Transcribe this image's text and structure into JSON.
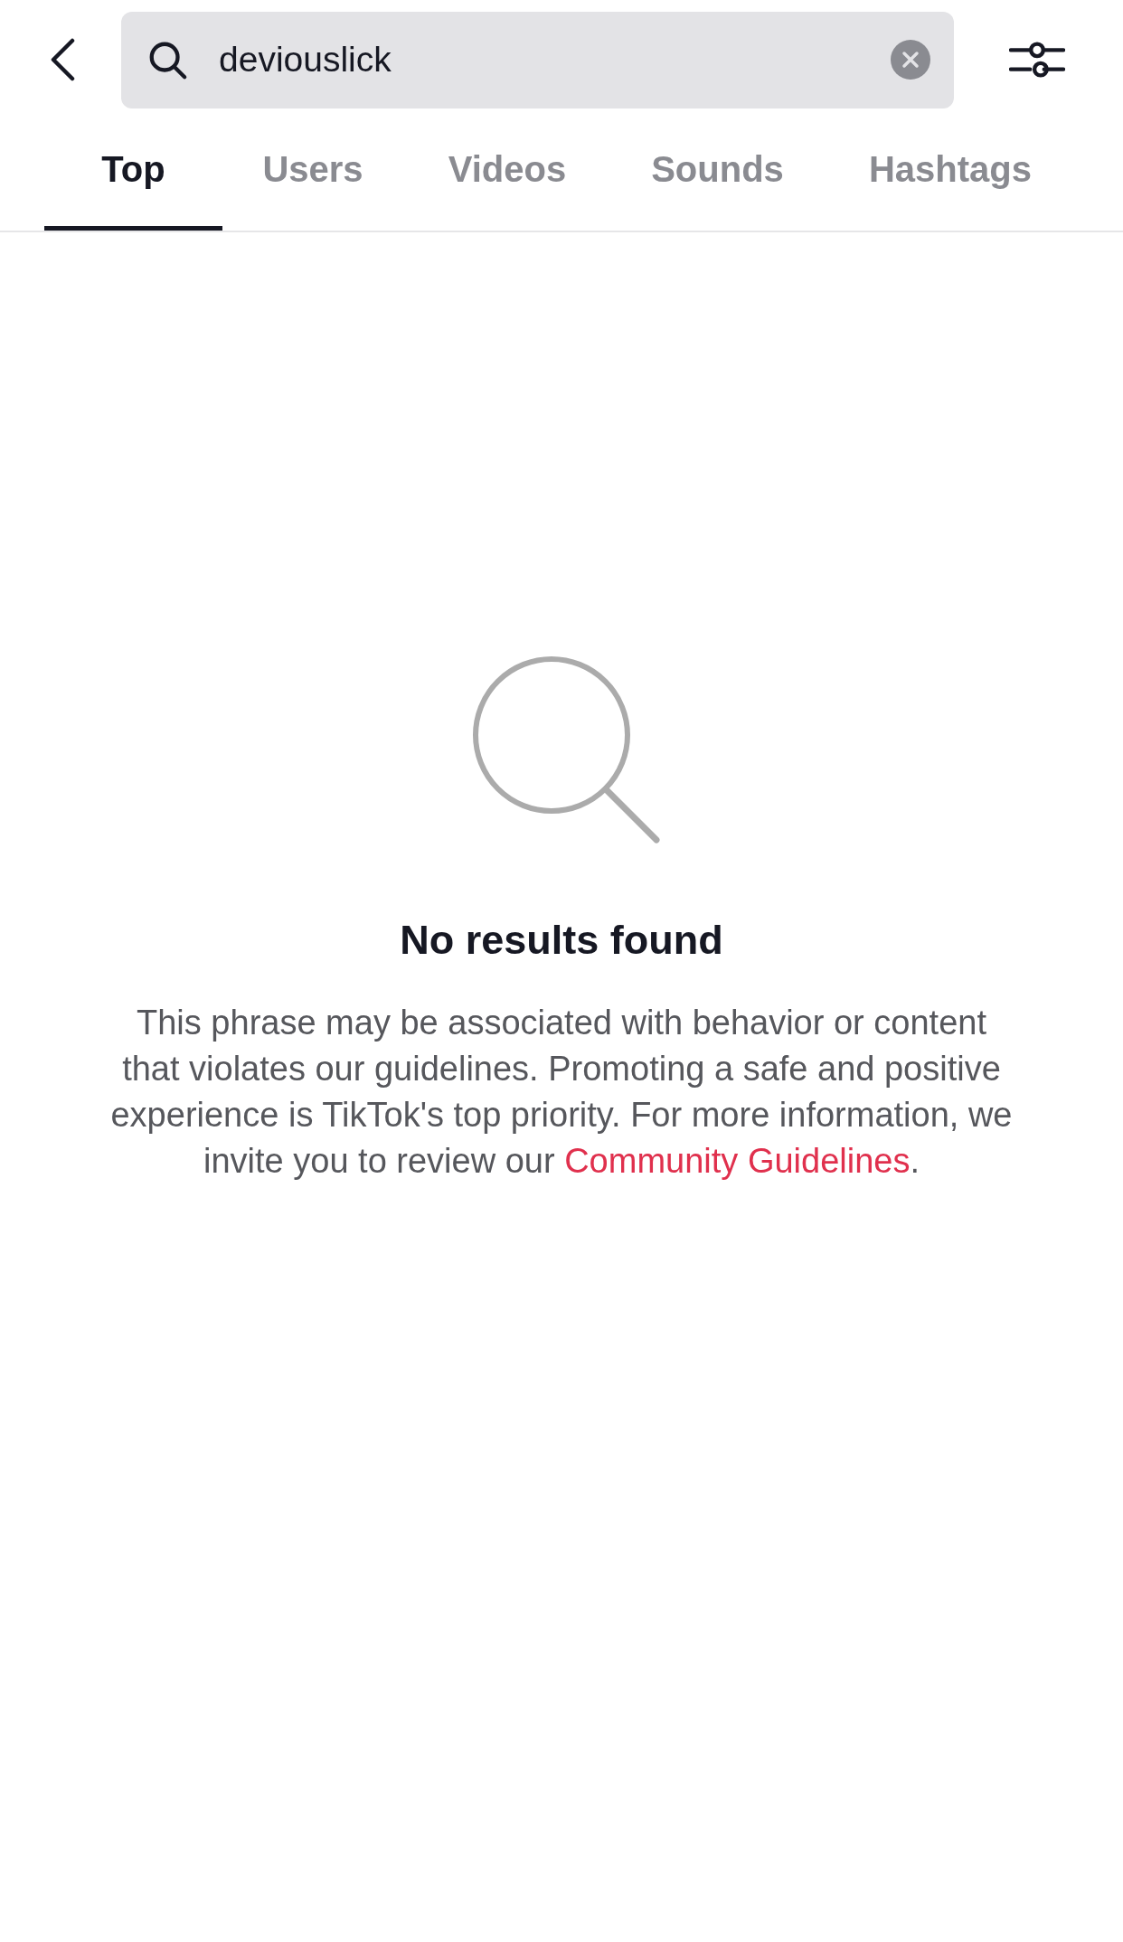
{
  "search": {
    "value": "deviouslick"
  },
  "tabs": [
    {
      "label": "Top",
      "selected": true
    },
    {
      "label": "Users",
      "selected": false
    },
    {
      "label": "Videos",
      "selected": false
    },
    {
      "label": "Sounds",
      "selected": false
    },
    {
      "label": "Hashtags",
      "selected": false
    }
  ],
  "empty_state": {
    "title": "No results found",
    "message": "This phrase may be associated with behavior or content that violates our guidelines. Promoting a safe and positive experience is TikTok's top priority. For more information, we invite you to review our",
    "link": "Community Guidelines",
    "after_link": "."
  }
}
